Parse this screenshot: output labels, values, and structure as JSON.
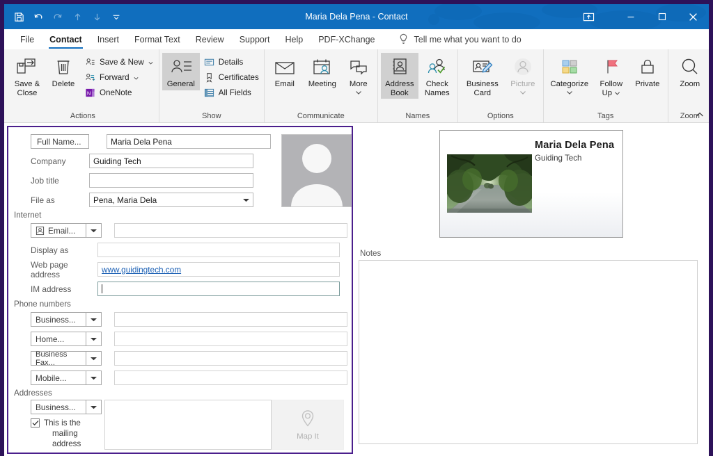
{
  "window": {
    "title": "Maria Dela Pena  -  Contact",
    "quick_access": [
      {
        "name": "save-icon",
        "label": "Save",
        "enabled": true
      },
      {
        "name": "undo-icon",
        "label": "Undo",
        "enabled": true
      },
      {
        "name": "redo-icon",
        "label": "Redo",
        "enabled": false
      },
      {
        "name": "previous-item-icon",
        "label": "Previous Item",
        "enabled": false
      },
      {
        "name": "next-item-icon",
        "label": "Next Item",
        "enabled": false
      },
      {
        "name": "customize-quick-access-icon",
        "label": "Customize Quick Access Toolbar",
        "enabled": true
      }
    ],
    "controls": {
      "ribbon_display": "Ribbon Display Options",
      "minimize": "Minimize",
      "maximize": "Maximize",
      "close": "Close"
    }
  },
  "tabs": [
    {
      "label": "File",
      "active": false
    },
    {
      "label": "Contact",
      "active": true
    },
    {
      "label": "Insert",
      "active": false
    },
    {
      "label": "Format Text",
      "active": false
    },
    {
      "label": "Review",
      "active": false
    },
    {
      "label": "Support",
      "active": false
    },
    {
      "label": "Help",
      "active": false
    },
    {
      "label": "PDF-XChange",
      "active": false
    }
  ],
  "tellme": {
    "icon": "lightbulb-icon",
    "placeholder": "Tell me what you want to do"
  },
  "ribbon": {
    "collapse_label": "Collapse the Ribbon",
    "groups": [
      {
        "label": "Actions",
        "big": [
          {
            "label": "Save &\nClose",
            "line1": "Save &",
            "line2": "Close",
            "icon": "save-and-close-icon"
          },
          {
            "label": "Delete",
            "line1": "Delete",
            "line2": "",
            "icon": "delete-icon"
          }
        ],
        "small": [
          {
            "label": "Save & New",
            "icon": "save-and-new-icon",
            "has_caret": true
          },
          {
            "label": "Forward",
            "icon": "forward-icon",
            "has_caret": true
          },
          {
            "label": "OneNote",
            "icon": "onenote-icon",
            "has_caret": false
          }
        ]
      },
      {
        "label": "Show",
        "big": [
          {
            "label": "General",
            "line1": "General",
            "line2": "",
            "icon": "general-contact-icon",
            "selected": true
          }
        ],
        "small": [
          {
            "label": "Details",
            "icon": "details-icon",
            "has_caret": false
          },
          {
            "label": "Certificates",
            "icon": "certificates-icon",
            "has_caret": false
          },
          {
            "label": "All Fields",
            "icon": "all-fields-icon",
            "has_caret": false
          }
        ]
      },
      {
        "label": "Communicate",
        "big": [
          {
            "label": "Email",
            "line1": "Email",
            "line2": "",
            "icon": "email-icon"
          },
          {
            "label": "Meeting",
            "line1": "Meeting",
            "line2": "",
            "icon": "meeting-icon"
          },
          {
            "label": "More",
            "line1": "More",
            "line2": "",
            "icon": "more-icon",
            "has_caret": true
          }
        ],
        "small": []
      },
      {
        "label": "Names",
        "big": [
          {
            "label": "Address Book",
            "line1": "Address",
            "line2": "Book",
            "icon": "address-book-icon",
            "selected": true
          },
          {
            "label": "Check Names",
            "line1": "Check",
            "line2": "Names",
            "icon": "check-names-icon"
          }
        ],
        "small": []
      },
      {
        "label": "Options",
        "big": [
          {
            "label": "Business Card",
            "line1": "Business",
            "line2": "Card",
            "icon": "business-card-icon"
          },
          {
            "label": "Picture",
            "line1": "Picture",
            "line2": "",
            "icon": "picture-icon",
            "has_caret": true,
            "disabled": true
          }
        ],
        "small": []
      },
      {
        "label": "Tags",
        "big": [
          {
            "label": "Categorize",
            "line1": "Categorize",
            "line2": "",
            "icon": "categorize-icon",
            "has_caret": true
          },
          {
            "label": "Follow Up",
            "line1": "Follow",
            "line2": "Up",
            "icon": "follow-up-flag-icon",
            "has_caret": true
          },
          {
            "label": "Private",
            "line1": "Private",
            "line2": "",
            "icon": "private-lock-icon"
          }
        ],
        "small": []
      },
      {
        "label": "Zoom",
        "big": [
          {
            "label": "Zoom",
            "line1": "Zoom",
            "line2": "",
            "icon": "zoom-magnifier-icon"
          }
        ],
        "small": []
      }
    ]
  },
  "form": {
    "name_row": {
      "button_label": "Full Name...",
      "value": "Maria Dela Pena"
    },
    "company_row": {
      "label": "Company",
      "value": "Guiding Tech"
    },
    "jobtitle_row": {
      "label": "Job title",
      "value": ""
    },
    "fileas_row": {
      "label": "File as",
      "value": "Pena, Maria Dela"
    },
    "internet": {
      "header": "Internet",
      "email": {
        "button_label": "Email...",
        "icon": "contact-card-icon",
        "value": ""
      },
      "display_as": {
        "label": "Display as",
        "value": ""
      },
      "web_page": {
        "label": "Web page address",
        "value": "www.guidingtech.com"
      },
      "im_address": {
        "label": "IM address",
        "value": "",
        "focused": true
      }
    },
    "phones": {
      "header": "Phone numbers",
      "rows": [
        {
          "label": "Business...",
          "value": ""
        },
        {
          "label": "Home...",
          "value": ""
        },
        {
          "label": "Business Fax...",
          "value": ""
        },
        {
          "label": "Mobile...",
          "value": ""
        }
      ]
    },
    "addresses": {
      "header": "Addresses",
      "type_label": "Business...",
      "checkbox_line1": "This is the",
      "checkbox_line2": "mailing address",
      "checkbox_checked": true,
      "address_value": "",
      "map_it_label": "Map It",
      "map_it_icon": "map-pin-icon"
    },
    "photo_placeholder": {
      "icon": "contact-photo-placeholder-icon"
    }
  },
  "preview": {
    "business_card": {
      "name": "Maria Dela Pena",
      "company": "Guiding Tech",
      "image_alt": "tree-lined-road-photo"
    },
    "notes": {
      "label": "Notes",
      "value": ""
    }
  },
  "colors": {
    "titlebar": "#106ebe",
    "accent": "#106ebe",
    "frame": "#2d1259",
    "focus_border": "#4b1f8c",
    "ribbon_bg": "#f4f4f4",
    "link": "#1a5fb4"
  }
}
